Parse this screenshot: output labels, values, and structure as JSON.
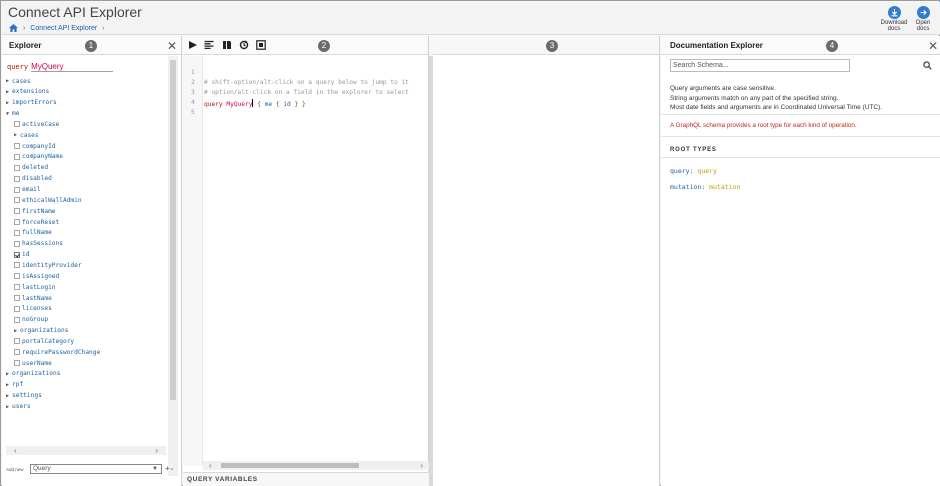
{
  "header": {
    "title": "Connect API Explorer",
    "breadcrumb_item": "Connect API Explorer",
    "download_label_1": "Download",
    "download_label_2": "docs",
    "open_label_1": "Open",
    "open_label_2": "docs"
  },
  "explorer": {
    "title": "Explorer",
    "badge": "1",
    "query_keyword": "query",
    "query_name": "MyQuery",
    "tree": [
      {
        "label": "cases",
        "kind": "caret",
        "indent": 0
      },
      {
        "label": "extensions",
        "kind": "caret",
        "indent": 0
      },
      {
        "label": "importErrors",
        "kind": "caret",
        "indent": 0
      },
      {
        "label": "me",
        "kind": "caret-open",
        "indent": 0
      },
      {
        "label": "activeCase",
        "kind": "check",
        "indent": 1
      },
      {
        "label": "cases",
        "kind": "caret",
        "indent": 1
      },
      {
        "label": "companyId",
        "kind": "check",
        "indent": 1
      },
      {
        "label": "companyName",
        "kind": "check",
        "indent": 1
      },
      {
        "label": "deleted",
        "kind": "check",
        "indent": 1
      },
      {
        "label": "disabled",
        "kind": "check",
        "indent": 1
      },
      {
        "label": "email",
        "kind": "check",
        "indent": 1
      },
      {
        "label": "ethicalWallAdmin",
        "kind": "check",
        "indent": 1
      },
      {
        "label": "firstName",
        "kind": "check",
        "indent": 1
      },
      {
        "label": "forceReset",
        "kind": "check",
        "indent": 1
      },
      {
        "label": "fullName",
        "kind": "check",
        "indent": 1
      },
      {
        "label": "hasSessions",
        "kind": "check",
        "indent": 1
      },
      {
        "label": "id",
        "kind": "check-on",
        "indent": 1
      },
      {
        "label": "identityProvider",
        "kind": "check",
        "indent": 1
      },
      {
        "label": "isAssigned",
        "kind": "check",
        "indent": 1
      },
      {
        "label": "lastLogin",
        "kind": "check",
        "indent": 1
      },
      {
        "label": "lastName",
        "kind": "check",
        "indent": 1
      },
      {
        "label": "licenses",
        "kind": "check",
        "indent": 1
      },
      {
        "label": "noGroup",
        "kind": "check",
        "indent": 1
      },
      {
        "label": "organizations",
        "kind": "caret",
        "indent": 1
      },
      {
        "label": "portalCategory",
        "kind": "check",
        "indent": 1
      },
      {
        "label": "requirePasswordChange",
        "kind": "check",
        "indent": 1
      },
      {
        "label": "userName",
        "kind": "check",
        "indent": 1
      },
      {
        "label": "organizations",
        "kind": "caret",
        "indent": 0
      },
      {
        "label": "rpf",
        "kind": "caret",
        "indent": 0
      },
      {
        "label": "settings",
        "kind": "caret",
        "indent": 0
      },
      {
        "label": "users",
        "kind": "caret",
        "indent": 0
      }
    ],
    "footer_label": "Add new",
    "operation_select": "Query",
    "add_symbol": "+"
  },
  "editor": {
    "badge": "2",
    "line_numbers": [
      "1",
      "2",
      "3",
      "4",
      "5"
    ],
    "comment_line_2": "# shift-option/alt-click on a query below to jump to it",
    "comment_line_3": "# option/alt-click on a field in the explorer to select",
    "query_kw": "query",
    "query_name": "MyQuery",
    "query_rest_open": "{",
    "query_field_me": "me",
    "query_brace_open": "{",
    "query_field_id": "id",
    "query_braces_close": "} }",
    "query_variables": "QUERY VARIABLES"
  },
  "result": {
    "badge": "3"
  },
  "docs": {
    "title": "Documentation Explorer",
    "badge": "4",
    "search_placeholder": "Search Schema...",
    "line_1": "Query arguments are case sensitive.",
    "line_2": "String arguments match on any part of the specified string.",
    "line_3": "Most date fields and arguments are in Coordinated Universal Time (UTC).",
    "red_note": "A GraphQL schema provides a root type for each kind of operation.",
    "section": "ROOT TYPES",
    "types": [
      {
        "key": "query",
        "value": "query"
      },
      {
        "key": "mutation",
        "value": "mutation"
      }
    ]
  },
  "colors": {
    "accent_blue": "#2f7dd1",
    "keyword": "#b11a04",
    "name": "#d2054e",
    "field": "#1f61a0",
    "type": "#ca9800",
    "red_note": "#c0261b"
  }
}
